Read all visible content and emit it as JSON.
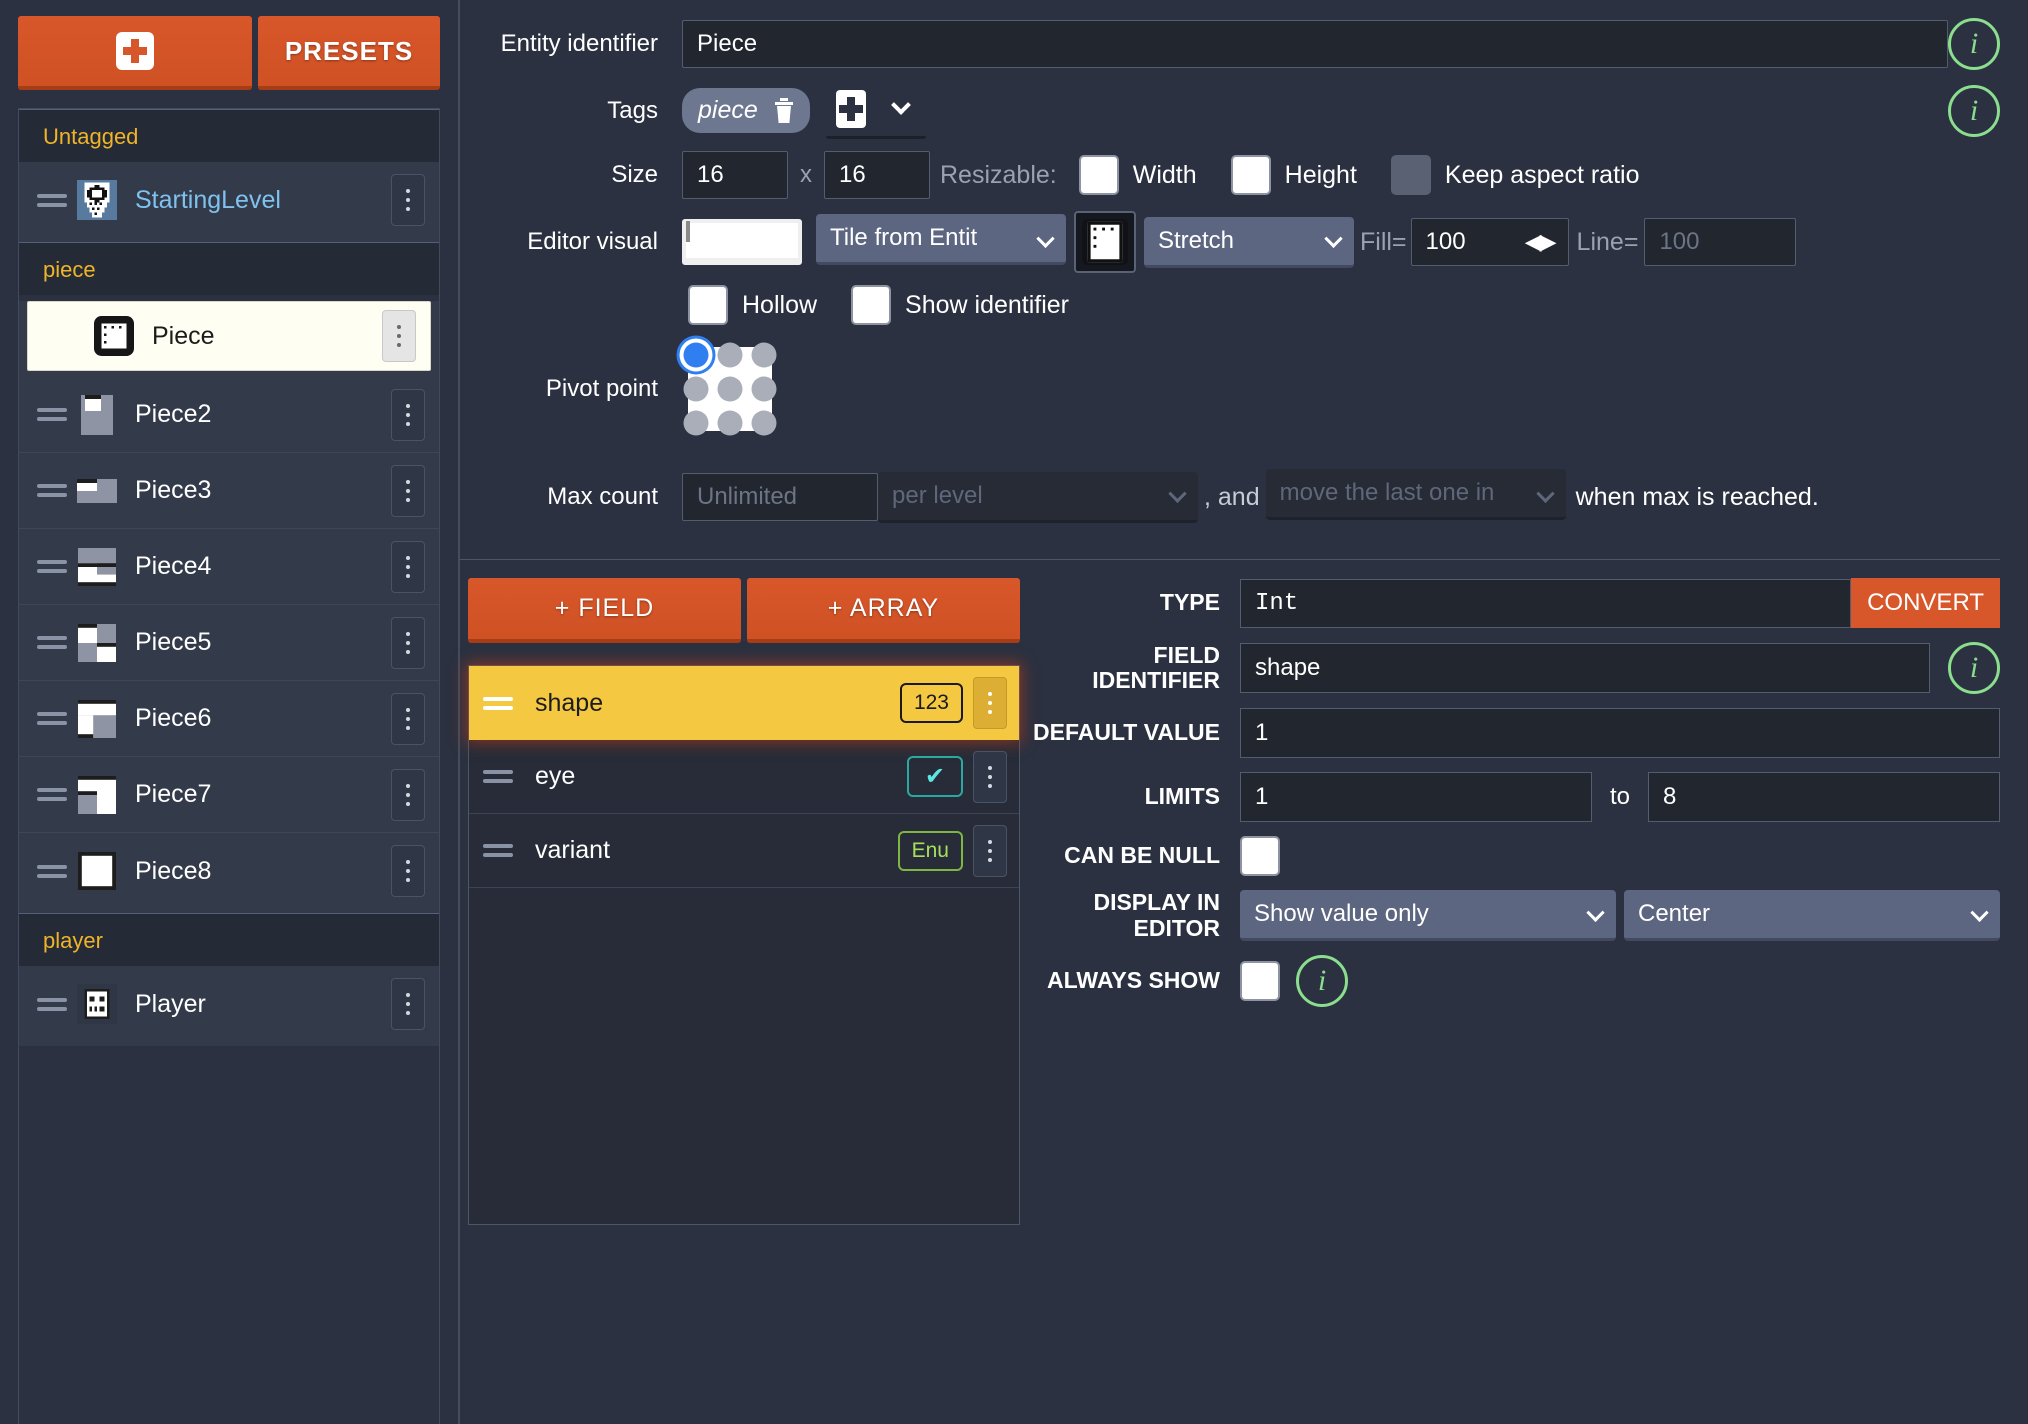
{
  "sidebar": {
    "add_button_icon": "plus-icon",
    "presets_label": "PRESETS",
    "groups": [
      {
        "name": "Untagged",
        "items": [
          {
            "label": "StartingLevel",
            "selected": false,
            "link": true
          }
        ]
      },
      {
        "name": "piece",
        "items": [
          {
            "label": "Piece",
            "selected": true,
            "link": false
          },
          {
            "label": "Piece2",
            "selected": false,
            "link": false
          },
          {
            "label": "Piece3",
            "selected": false,
            "link": false
          },
          {
            "label": "Piece4",
            "selected": false,
            "link": false
          },
          {
            "label": "Piece5",
            "selected": false,
            "link": false
          },
          {
            "label": "Piece6",
            "selected": false,
            "link": false
          },
          {
            "label": "Piece7",
            "selected": false,
            "link": false
          },
          {
            "label": "Piece8",
            "selected": false,
            "link": false
          }
        ]
      },
      {
        "name": "player",
        "items": [
          {
            "label": "Player",
            "selected": false,
            "link": false
          }
        ]
      }
    ]
  },
  "entity": {
    "identifier_label": "Entity identifier",
    "identifier_value": "Piece",
    "tags_label": "Tags",
    "tags": [
      "piece"
    ],
    "size_label": "Size",
    "size_width": "16",
    "size_height": "16",
    "size_separator": "x",
    "resizable_label": "Resizable:",
    "resizable_width_label": "Width",
    "resizable_height_label": "Height",
    "keep_aspect_label": "Keep aspect ratio",
    "editor_visual_label": "Editor visual",
    "render_mode": "Tile from Entity tileset",
    "render_mode_display": "Tile from Entit",
    "tile_fit": "Stretch",
    "fill_label": "Fill=",
    "fill_value": "100",
    "line_label": "Line=",
    "line_value": "100",
    "hollow_label": "Hollow",
    "show_identifier_label": "Show identifier",
    "pivot_label": "Pivot point",
    "pivot_selected_index": 0,
    "max_count_label": "Max count",
    "max_count_placeholder": "Unlimited",
    "max_count_scope": "per level",
    "max_count_and": ", and",
    "max_count_action": "move the last one in",
    "max_count_tail": "when max is reached."
  },
  "fields": {
    "add_field_label": "+ FIELD",
    "add_array_label": "+ ARRAY",
    "list": [
      {
        "name": "shape",
        "badge": "123",
        "badge_kind": "int",
        "active": true
      },
      {
        "name": "eye",
        "badge": "✔",
        "badge_kind": "bool",
        "active": false
      },
      {
        "name": "variant",
        "badge": "Enu",
        "badge_kind": "enum",
        "active": false
      }
    ]
  },
  "field_props": {
    "type_label": "TYPE",
    "type_value": "Int",
    "convert_label": "CONVERT",
    "identifier_label": "FIELD IDENTIFIER",
    "identifier_label_line1": "FIELD",
    "identifier_label_line2": "IDENTIFIER",
    "identifier_value": "shape",
    "default_value_label": "DEFAULT VALUE",
    "default_value": "1",
    "limits_label": "LIMITS",
    "limits_min": "1",
    "limits_to": "to",
    "limits_max": "8",
    "can_be_null_label": "CAN BE NULL",
    "display_in_editor_label": "DISPLAY IN EDITOR",
    "display_in_editor_line1": "DISPLAY IN",
    "display_in_editor_line2": "EDITOR",
    "display_mode": "Show value only",
    "display_position": "Center",
    "always_show_label": "ALWAYS SHOW"
  },
  "colors": {
    "accent_orange": "#d8572a",
    "group_yellow": "#f0b429",
    "field_active": "#f5c842",
    "info_green": "#8ade8d",
    "link_blue": "#7fc2ef",
    "pivot_blue": "#2f7ff0",
    "panel_bg": "#2b3140"
  }
}
